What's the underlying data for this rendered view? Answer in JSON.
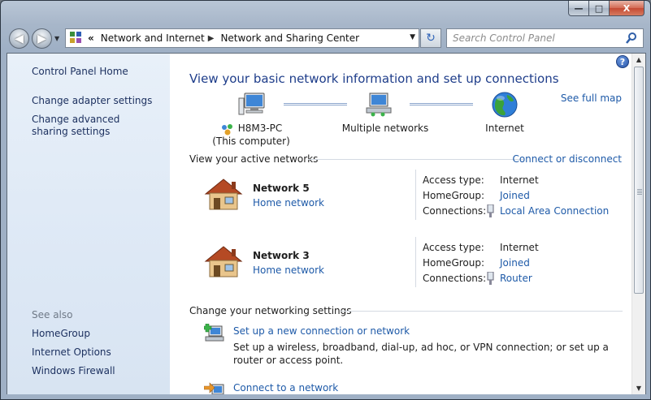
{
  "window": {
    "caption_buttons": {
      "minimize": "—",
      "maximize": "□",
      "close": "X"
    }
  },
  "navigation": {
    "back_glyph": "◀",
    "forward_glyph": "▶",
    "breadcrumb_chevron": "«",
    "breadcrumb_separator": "▶",
    "crumbs": [
      "Network and Internet",
      "Network and Sharing Center"
    ],
    "refresh_glyph": "↻"
  },
  "search": {
    "placeholder": "Search Control Panel",
    "icon": "magnifier-icon"
  },
  "sidebar": {
    "home": "Control Panel Home",
    "links": [
      "Change adapter settings",
      "Change advanced sharing settings"
    ],
    "see_also_label": "See also",
    "see_also": [
      "HomeGroup",
      "Internet Options",
      "Windows Firewall"
    ]
  },
  "main": {
    "help_glyph": "?",
    "title": "View your basic network information and set up connections",
    "see_full_map": "See full map",
    "map": {
      "computer_name": "H8M3-PC",
      "computer_sub": "(This computer)",
      "middle": "Multiple networks",
      "internet": "Internet"
    },
    "active_header": "View your active networks",
    "connect_disconnect": "Connect or disconnect",
    "labels": {
      "access": "Access type:",
      "homegroup": "HomeGroup:",
      "connections": "Connections:"
    },
    "networks": [
      {
        "name": "Network  5",
        "type": "Home network",
        "access": "Internet",
        "homegroup": "Joined",
        "connection": "Local Area Connection"
      },
      {
        "name": "Network  3",
        "type": "Home network",
        "access": "Internet",
        "homegroup": "Joined",
        "connection": "Router"
      }
    ],
    "change_header": "Change your networking settings",
    "tasks": [
      {
        "link": "Set up a new connection or network",
        "desc": "Set up a wireless, broadband, dial-up, ad hoc, or VPN connection; or set up a router or access point."
      },
      {
        "link": "Connect to a network",
        "desc": ""
      }
    ]
  },
  "scrollbar": {
    "up": "▲",
    "down": "▼"
  },
  "colors": {
    "link": "#1e5aa8",
    "title": "#1e3d8a",
    "sidebar_link": "#1b2f5e"
  }
}
